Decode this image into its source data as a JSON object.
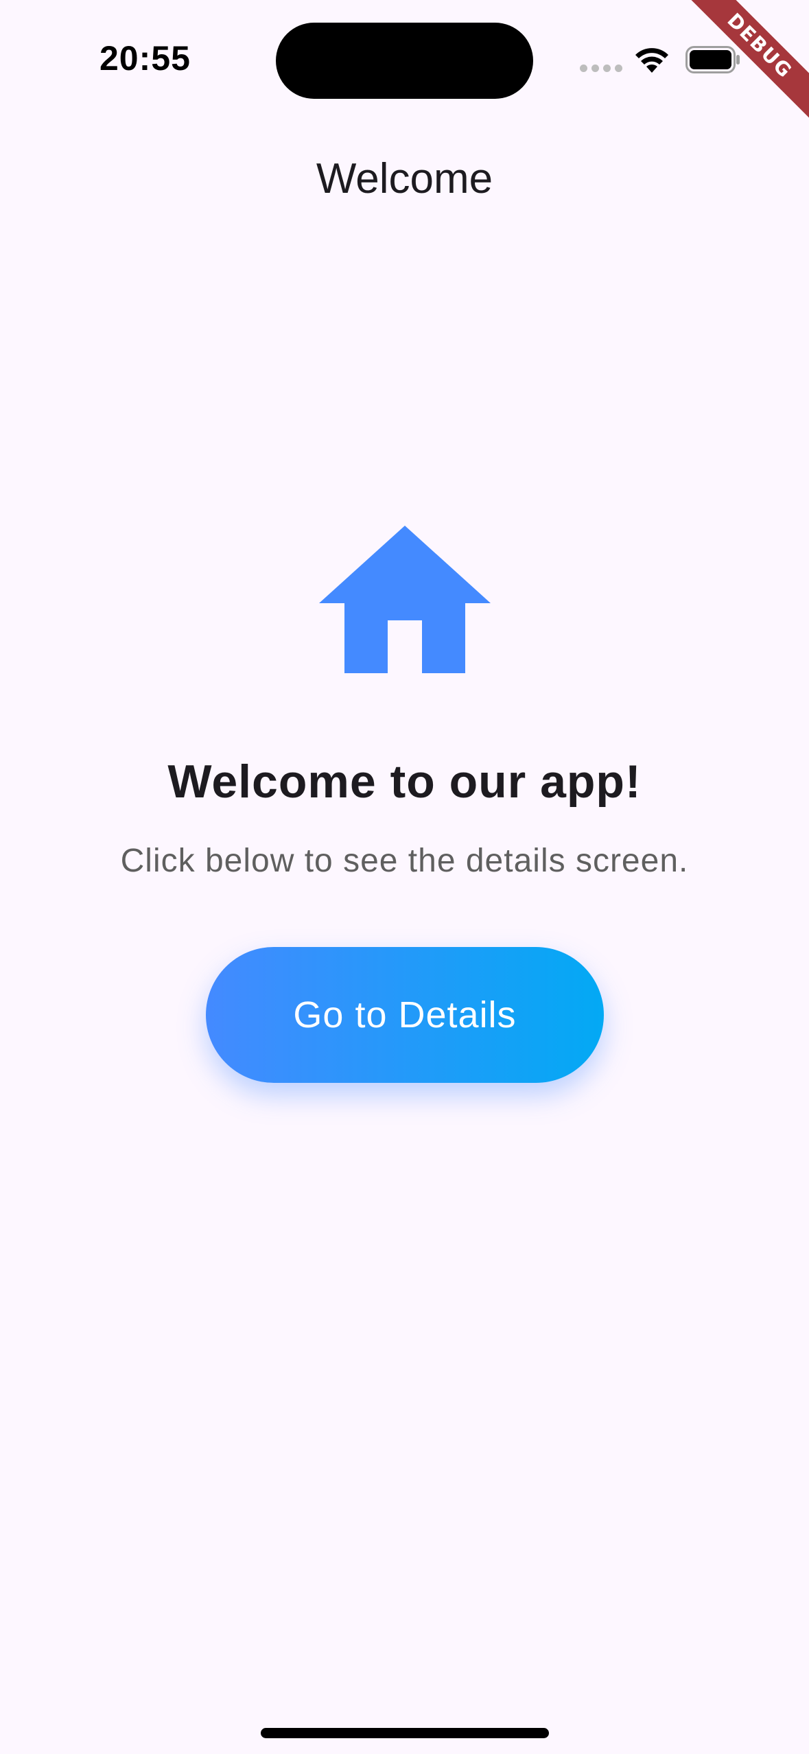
{
  "status_bar": {
    "time": "20:55",
    "debug_label": "DEBUG"
  },
  "app_bar": {
    "title": "Welcome"
  },
  "hero": {
    "icon": "home-icon",
    "headline": "Welcome to our app!",
    "subtitle": "Click below to see the details screen."
  },
  "actions": {
    "primary_label": "Go to Details"
  },
  "colors": {
    "background": "#fdf7ff",
    "accent": "#448aff",
    "accent_end": "#03a9f4",
    "debug_ribbon": "#a6373c"
  }
}
